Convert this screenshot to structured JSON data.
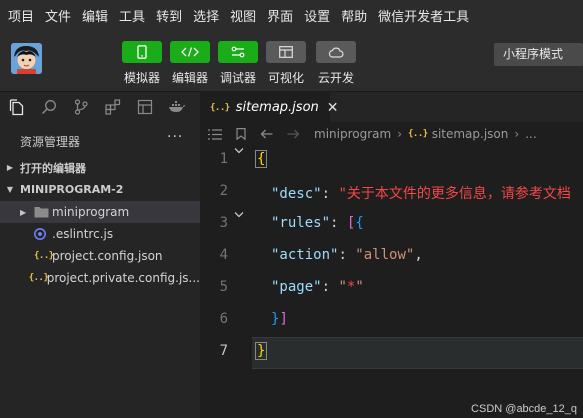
{
  "menu": [
    "项目",
    "文件",
    "编辑",
    "工具",
    "转到",
    "选择",
    "视图",
    "界面",
    "设置",
    "帮助",
    "微信开发者工具"
  ],
  "toolbar": {
    "buttons": [
      {
        "label": "模拟器",
        "icon": "phone-icon"
      },
      {
        "label": "编辑器",
        "icon": "code-icon"
      },
      {
        "label": "调试器",
        "icon": "debug-icon"
      },
      {
        "label": "可视化",
        "icon": "layout-icon"
      },
      {
        "label": "云开发",
        "icon": "cloud-icon"
      }
    ],
    "mode": "小程序模式"
  },
  "explorer": {
    "title": "资源管理器",
    "more": "···",
    "open_editors": "打开的编辑器",
    "project": "MINIPROGRAM-2",
    "items": [
      {
        "label": "miniprogram",
        "icon": "folder-icon"
      },
      {
        "label": ".eslintrc.js",
        "icon": "eslint-icon"
      },
      {
        "label": "project.config.json",
        "icon": "json-icon"
      },
      {
        "label": "project.private.config.js...",
        "icon": "json-icon"
      }
    ]
  },
  "json_icon_glyph": "{..}",
  "editor": {
    "tab": "sitemap.json",
    "tab_close": "✕",
    "breadcrumb": [
      "miniprogram",
      "sitemap.json",
      "..."
    ],
    "line_numbers": [
      "1",
      "2",
      "3",
      "4",
      "5",
      "6",
      "7"
    ],
    "lines": [
      "{",
      "\"desc\": \"关于本文件的更多信息，请参考文档",
      "\"rules\": [{",
      "\"action\": \"allow\",",
      "\"page\": \"*\"",
      "}]",
      "}"
    ]
  },
  "watermark": "CSDN @abcde_12_q",
  "colors": {
    "accent_green": "#1aad19",
    "key": "#9cdcfe",
    "string": "#ce9178",
    "bracket_gold": "#ffd700",
    "bracket_purple": "#da70d6"
  }
}
